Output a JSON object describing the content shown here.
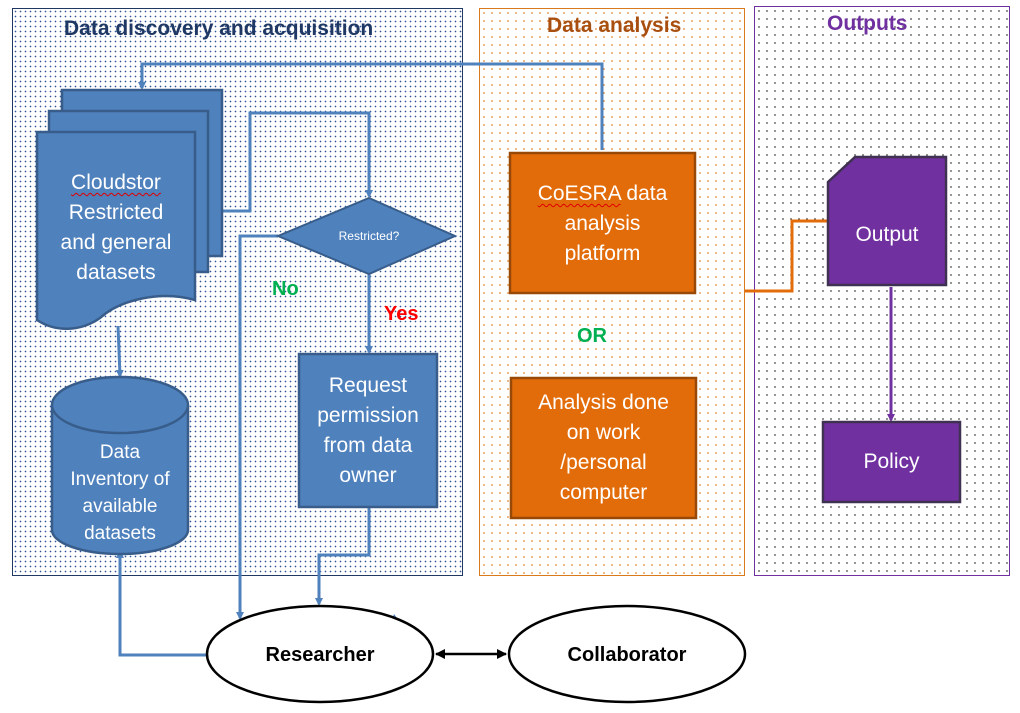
{
  "panels": {
    "discovery": {
      "title": "Data discovery and acquisition",
      "title_color": "#1f3864"
    },
    "analysis": {
      "title": "Data analysis",
      "title_color": "#a84f10"
    },
    "outputs": {
      "title": "Outputs",
      "title_color": "#7030a0"
    }
  },
  "nodes": {
    "cloudstor": {
      "line1": "Cloudstor",
      "line2": "Restricted",
      "line3": "and general",
      "line4": "datasets",
      "shape": "multi-document"
    },
    "inventory": {
      "line1": "Data",
      "line2": "Inventory of",
      "line3": "available",
      "line4": "datasets",
      "shape": "cylinder"
    },
    "decision": {
      "label": "Restricted?",
      "shape": "diamond"
    },
    "request": {
      "line1": "Request",
      "line2": "permission",
      "line3": "from data",
      "line4": "owner",
      "shape": "process"
    },
    "coesra": {
      "line1_a": "CoESRA",
      "line1_b": " data",
      "line2": "analysis",
      "line3": "platform",
      "shape": "process"
    },
    "or_label": "OR",
    "local": {
      "line1": "Analysis done",
      "line2": "on work",
      "line3": "/personal",
      "line4": "computer",
      "shape": "process"
    },
    "output": {
      "label": "Output",
      "shape": "snipped-rectangle"
    },
    "policy": {
      "label": "Policy",
      "shape": "process"
    },
    "researcher": {
      "label": "Researcher",
      "shape": "ellipse"
    },
    "collaborator": {
      "label": "Collaborator",
      "shape": "ellipse"
    }
  },
  "branches": {
    "no": "No",
    "yes": "Yes"
  },
  "colors": {
    "blue_fill": "#4f81bd",
    "blue_stroke": "#385d8a",
    "orange_fill": "#e36c0a",
    "orange_stroke": "#984807",
    "purple_fill": "#7030a0",
    "purple_stroke": "#3f3151",
    "no_green": "#00b050",
    "yes_red": "#ff0000",
    "or_green": "#00b050"
  }
}
